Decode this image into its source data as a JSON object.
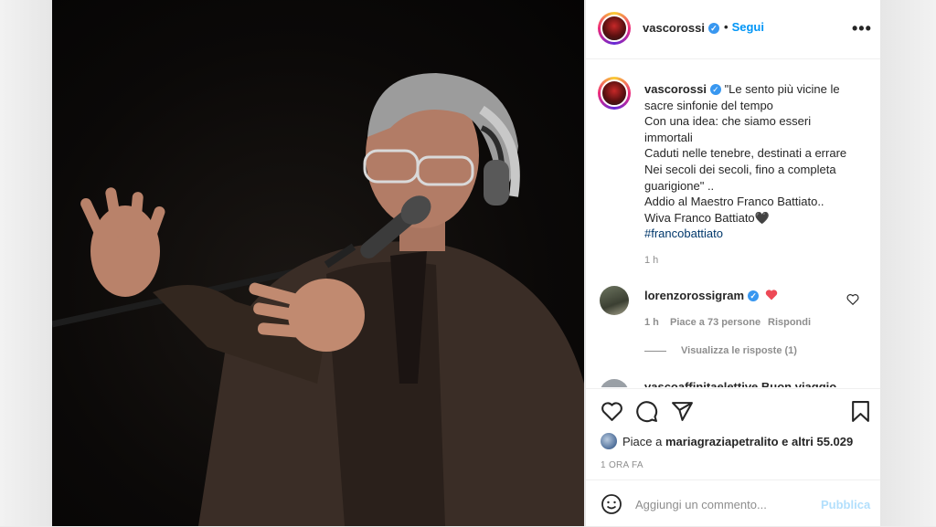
{
  "post": {
    "username": "vascorossi",
    "follow_label": "Segui",
    "more_label": "•••"
  },
  "caption": {
    "username": "vascorossi",
    "lines": [
      "\"Le sento più vicine le",
      "sacre sinfonie del tempo",
      "Con una idea: che siamo esseri",
      "immortali",
      "Caduti nelle tenebre, destinati a errare",
      "Nei secoli dei secoli, fino a completa",
      "guarigione\" ..",
      "Addio al Maestro Franco Battiato..",
      "Wiva Franco Battiato🖤"
    ],
    "hashtag": "#francobattiato",
    "time": "1 h"
  },
  "comment": {
    "username": "lorenzorossigram",
    "time": "1 h",
    "likes": "Piace a 73 persone",
    "reply": "Rispondi",
    "view_replies": "Visualizza le risposte (1)"
  },
  "next_comment_peek": "vascoaffinitaelettive Buon viaggio",
  "likes": {
    "prefix": "Piace a",
    "user": "mariagraziapetralito",
    "suffix": "e altri 55.029"
  },
  "date": "1 ORA FA",
  "add_comment": {
    "placeholder": "Aggiungi un commento...",
    "publish": "Pubblica"
  },
  "icons": {
    "like": "heart-icon",
    "comment": "comment-icon",
    "share": "send-icon",
    "save": "bookmark-icon",
    "emoji": "emoji-icon",
    "options": "more-icon",
    "verified": "verified-badge-icon"
  },
  "colors": {
    "link_blue": "#0095f6",
    "verified": "#3897f0",
    "hashtag": "#00376b",
    "heart_red": "#ed4956",
    "publish_disabled": "#b2dffc"
  }
}
